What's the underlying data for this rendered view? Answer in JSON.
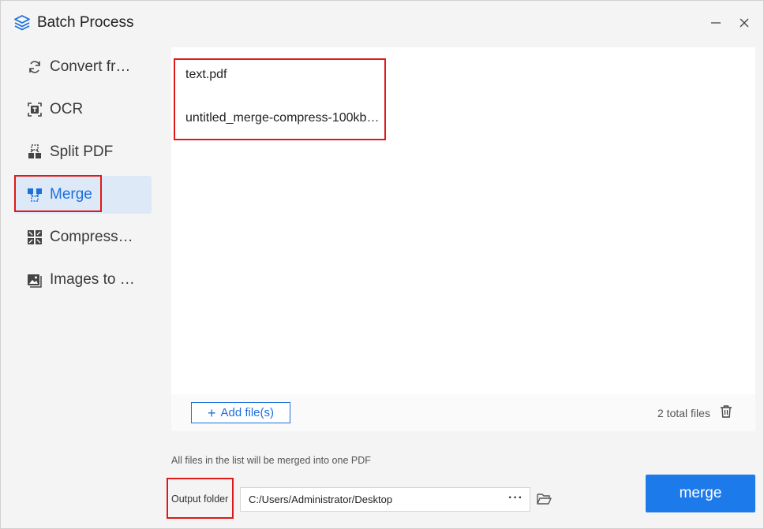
{
  "window": {
    "title": "Batch Process",
    "icons": {
      "app": "stack-layers-icon",
      "minimize": "minimize-icon",
      "close": "close-icon"
    }
  },
  "sidebar": {
    "items": [
      {
        "label": "Convert fr…",
        "icon": "convert-arrows-icon",
        "active": false
      },
      {
        "label": "OCR",
        "icon": "ocr-text-icon",
        "active": false
      },
      {
        "label": "Split PDF",
        "icon": "split-icon",
        "active": false
      },
      {
        "label": "Merge",
        "icon": "merge-icon",
        "active": true
      },
      {
        "label": "Compress…",
        "icon": "compress-icon",
        "active": false
      },
      {
        "label": "Images to …",
        "icon": "image-icon",
        "active": false
      }
    ]
  },
  "files": {
    "items": [
      {
        "name": "text.pdf"
      },
      {
        "name": "untitled_merge-compress-100kb…"
      }
    ],
    "add_label": "Add file(s)",
    "total_text": "2 total files"
  },
  "hint": "All files in the list will be merged into one PDF",
  "output": {
    "label": "Output folder",
    "path": "C:/Users/Administrator/Desktop",
    "browse_label": "···"
  },
  "action": {
    "merge_label": "merge"
  },
  "colors": {
    "accent": "#1d7aeb",
    "active_bg": "#dde9f7",
    "annotation": "#e01818"
  }
}
